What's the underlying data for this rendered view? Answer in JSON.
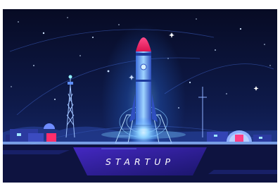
{
  "illustration": {
    "subject": "rocket-launch-night",
    "caption": "STARTUP",
    "colors": {
      "sky_top": "#0a0f2e",
      "sky_bottom": "#162a6a",
      "glow": "#2f7dff",
      "rocket_nose": "#ff2d6b",
      "ground": "#1b1f52",
      "panel": "#3a1fb8"
    }
  }
}
